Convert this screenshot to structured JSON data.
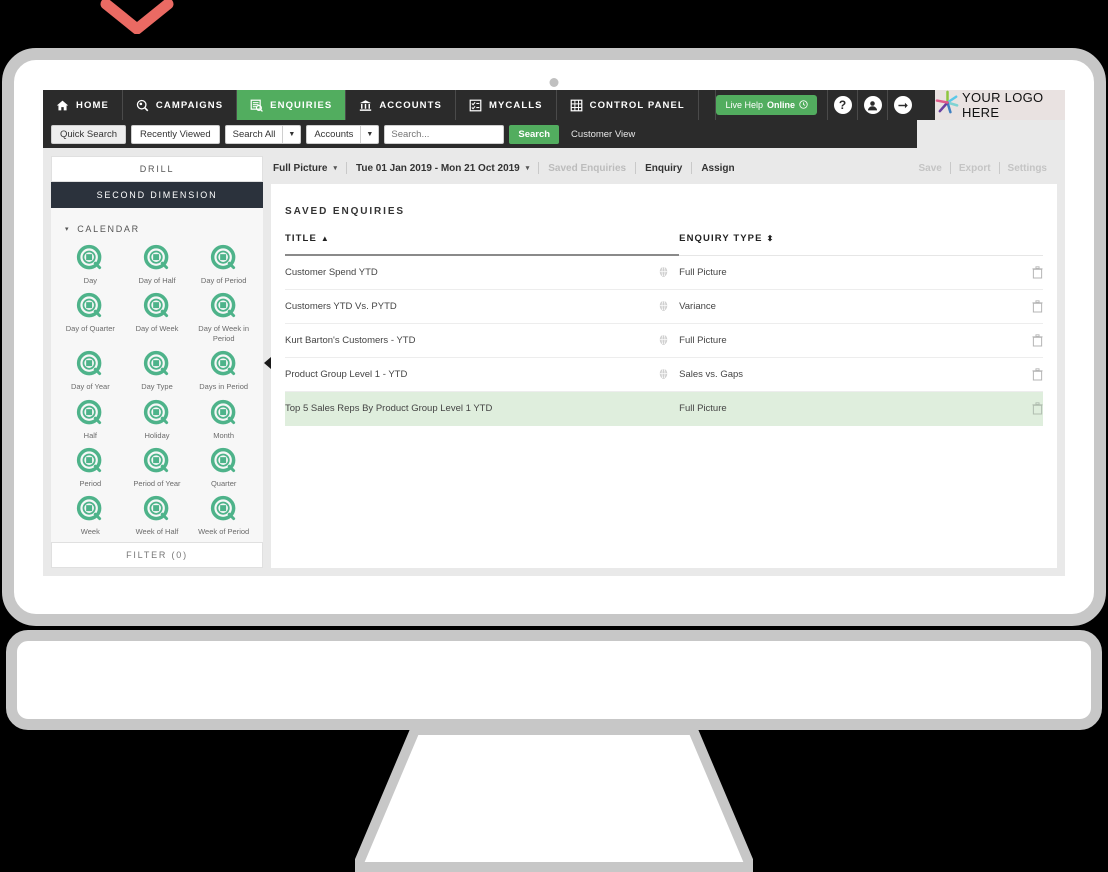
{
  "decoration": {
    "chevron_color": "#ea6a63"
  },
  "topnav": {
    "items": [
      {
        "label": "HOME",
        "icon": "home-icon",
        "active": false
      },
      {
        "label": "CAMPAIGNS",
        "icon": "megaphone-icon",
        "active": false
      },
      {
        "label": "ENQUIRIES",
        "icon": "report-search-icon",
        "active": true
      },
      {
        "label": "ACCOUNTS",
        "icon": "bank-icon",
        "active": false
      },
      {
        "label": "MYCALLS",
        "icon": "checklist-icon",
        "active": false
      },
      {
        "label": "CONTROL PANEL",
        "icon": "grid-panel-icon",
        "active": false
      }
    ],
    "live_help": {
      "prefix": "Live Help ",
      "status": "Online",
      "icon": "clock-icon"
    },
    "help_button": "?",
    "account_button": "account-icon",
    "logout_button": "logout-arrow-icon",
    "logo_text": "YOUR LOGO HERE",
    "active_color": "#52ad5f",
    "bar_color": "#2b2b2b"
  },
  "subnav": {
    "quick_search": "Quick Search",
    "recently_viewed": "Recently Viewed",
    "search_scope": "Search All",
    "entity_scope": "Accounts",
    "search_placeholder": "Search...",
    "search_value": "",
    "search_button": "Search",
    "customer_view": "Customer View"
  },
  "sidebar": {
    "drill_tab": "DRILL",
    "second_dimension_tab": "SECOND DIMENSION",
    "group_label": "CALENDAR",
    "group_caret": "▾",
    "filter_label": "FILTER (0)",
    "collapse_icon": "collapse-left-icon",
    "icon_name": "calendar-search-icon",
    "icon_color": "#4eb38a",
    "items": [
      {
        "label": "Day"
      },
      {
        "label": "Day of Half"
      },
      {
        "label": "Day of Period"
      },
      {
        "label": "Day of Quarter"
      },
      {
        "label": "Day of Week"
      },
      {
        "label": "Day of Week in Period"
      },
      {
        "label": "Day of Year"
      },
      {
        "label": "Day Type"
      },
      {
        "label": "Days in Period"
      },
      {
        "label": "Half"
      },
      {
        "label": "Holiday"
      },
      {
        "label": "Month"
      },
      {
        "label": "Period"
      },
      {
        "label": "Period of Year"
      },
      {
        "label": "Quarter"
      },
      {
        "label": "Week"
      },
      {
        "label": "Week of Half"
      },
      {
        "label": "Week of Period"
      },
      {
        "label": ""
      },
      {
        "label": ""
      },
      {
        "label": ""
      }
    ]
  },
  "toolbar": {
    "view_mode": "Full Picture",
    "view_caret": "▾",
    "date_range": "Tue 01 Jan 2019 - Mon 21 Oct 2019",
    "date_caret": "▾",
    "saved_enquiries": "Saved Enquiries",
    "enquiry": "Enquiry",
    "assign": "Assign",
    "save": "Save",
    "export": "Export",
    "settings": "Settings"
  },
  "panel": {
    "title": "SAVED ENQUIRIES",
    "columns": {
      "title": "TITLE",
      "title_sort": "▲",
      "enquiry_type": "ENQUIRY TYPE",
      "type_sort": "⬍"
    },
    "rows": [
      {
        "title": "Customer Spend YTD",
        "globe": true,
        "type": "Full Picture",
        "selected": false
      },
      {
        "title": "Customers YTD Vs. PYTD",
        "globe": true,
        "type": "Variance",
        "selected": false
      },
      {
        "title": "Kurt Barton's Customers - YTD",
        "globe": true,
        "type": "Full Picture",
        "selected": false
      },
      {
        "title": "Product Group Level 1 - YTD",
        "globe": true,
        "type": "Sales vs. Gaps",
        "selected": false
      },
      {
        "title": "Top 5 Sales Reps By Product Group Level 1 YTD",
        "globe": false,
        "type": "Full Picture",
        "selected": true
      }
    ],
    "delete_icon": "trash-icon",
    "globe_icon": "globe-icon",
    "selected_row_color": "#dfeedd"
  }
}
